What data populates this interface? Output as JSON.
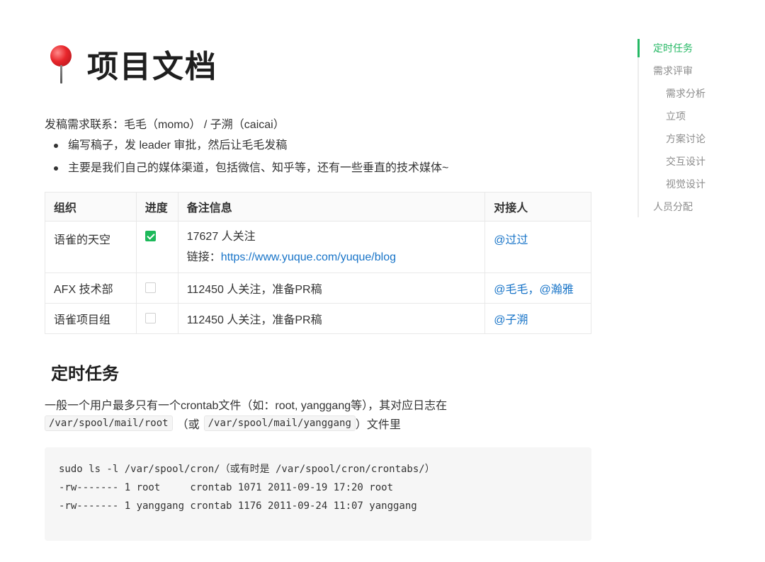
{
  "page": {
    "title": "项目文档"
  },
  "intro": {
    "contact": "发稿需求联系：毛毛（momo） / 子溯（caicai）",
    "bullets": [
      "编写稿子，发 leader 审批，然后让毛毛发稿",
      "主要是我们自己的媒体渠道，包括微信、知乎等，还有一些垂直的技术媒体~"
    ]
  },
  "table": {
    "headers": [
      "组织",
      "进度",
      "备注信息",
      "对接人"
    ],
    "rows": [
      {
        "org": "语雀的天空",
        "done": true,
        "note": "17627 人关注",
        "link_label": "链接：",
        "link": "https://www.yuque.com/yuque/blog",
        "contact": "@过过"
      },
      {
        "org": "AFX 技术部",
        "done": false,
        "note": "112450 人关注，准备PR稿",
        "contact": "@毛毛，@瀚雅"
      },
      {
        "org": "语雀项目组",
        "done": false,
        "note": "112450 人关注，准备PR稿",
        "contact": "@子溯"
      }
    ]
  },
  "section": {
    "title": "定时任务",
    "para1": "一般一个用户最多只有一个crontab文件（如：root, yanggang等），其对应日志在",
    "path1": "/var/spool/mail/root",
    "or_text": "（或",
    "path2": "/var/spool/mail/yanggang",
    "tail": "）文件里",
    "code_lines": [
      "sudo ls -l /var/spool/cron/（或有时是 /var/spool/cron/crontabs/）",
      "-rw------- 1 root     crontab 1071 2011-09-19 17:20 root",
      "-rw------- 1 yanggang crontab 1176 2011-09-24 11:07 yanggang"
    ]
  },
  "toc": {
    "items": [
      {
        "label": "定时任务",
        "level": 1,
        "active": true
      },
      {
        "label": "需求评审",
        "level": 1,
        "active": false
      },
      {
        "label": "需求分析",
        "level": 2,
        "active": false
      },
      {
        "label": "立项",
        "level": 2,
        "active": false
      },
      {
        "label": "方案讨论",
        "level": 2,
        "active": false
      },
      {
        "label": "交互设计",
        "level": 2,
        "active": false
      },
      {
        "label": "视觉设计",
        "level": 2,
        "active": false
      },
      {
        "label": "人员分配",
        "level": 1,
        "active": false
      }
    ]
  },
  "colors": {
    "accent": "#25b864",
    "link": "#1874c8",
    "checkbox_on": "#1db95a"
  },
  "icons": {
    "title_icon": "pushpin-icon"
  }
}
